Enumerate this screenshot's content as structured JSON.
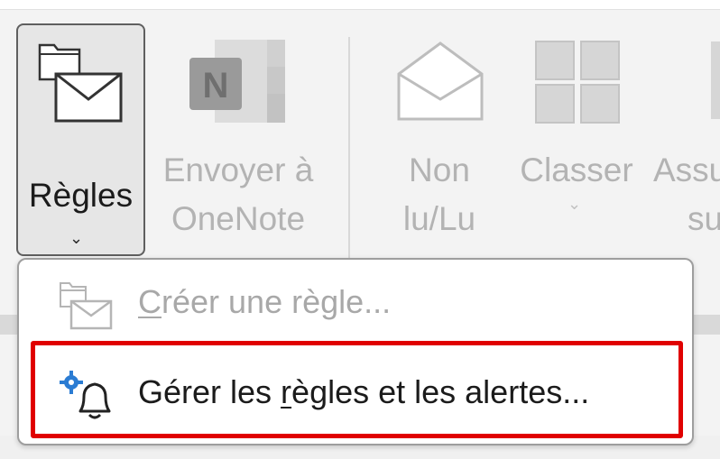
{
  "ribbon": {
    "rules_button": {
      "label": "Règles",
      "icon": "rules-icon",
      "chevron": "⌄"
    },
    "onenote_button": {
      "label_line1": "Envoyer à",
      "label_line2": "OneNote",
      "icon": "onenote-icon"
    },
    "read_button": {
      "label_line1": "Non",
      "label_line2": "lu/Lu",
      "icon": "envelope-open-icon"
    },
    "categorize_button": {
      "label": "Classer",
      "icon": "categories-icon",
      "chevron": "⌄"
    },
    "followup_button": {
      "label_line1": "Assu",
      "label_line2": "su"
    }
  },
  "rules_menu": {
    "items": [
      {
        "pre": "",
        "underlined": "C",
        "post": "réer une règle...",
        "icon": "create-rule-icon",
        "disabled": true
      },
      {
        "pre": "Gérer les ",
        "underlined": "r",
        "post": "ègles et les alertes...",
        "icon": "manage-rules-alerts-icon",
        "disabled": false,
        "highlighted": true
      }
    ]
  },
  "colors": {
    "highlight_border": "#e00000",
    "disabled_text": "#a8a8a8",
    "icon_blue": "#2b7cd3"
  }
}
